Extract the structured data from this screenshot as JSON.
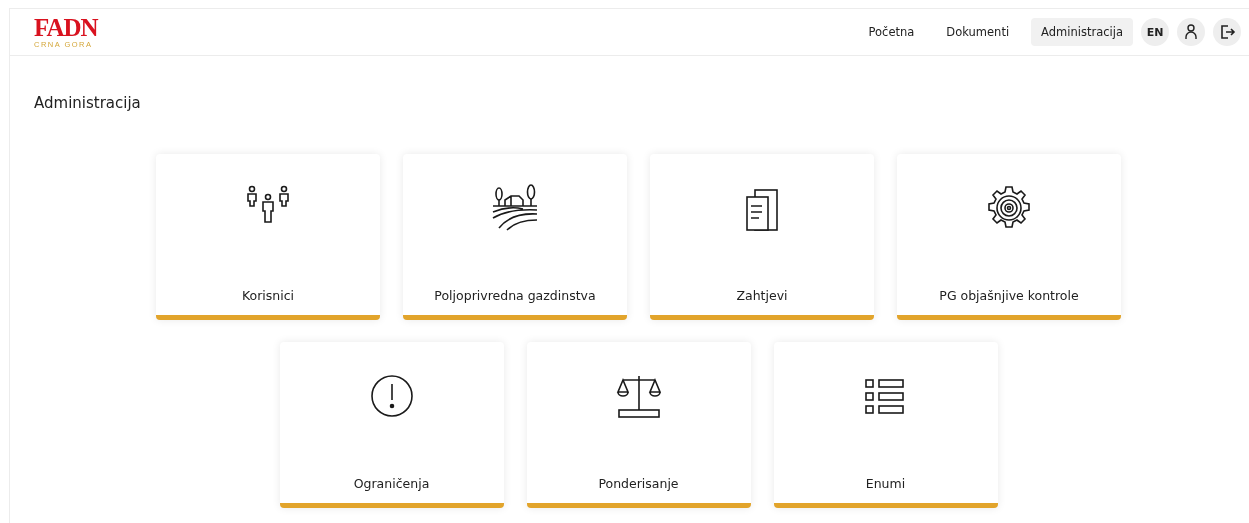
{
  "logo": {
    "title": "FADN",
    "subtitle": "CRNA GORA"
  },
  "nav": [
    {
      "label": "Početna",
      "selected": false
    },
    {
      "label": "Dokumenti",
      "selected": false
    },
    {
      "label": "Administracija",
      "selected": true
    }
  ],
  "language": "EN",
  "page_title": "Administracija",
  "tiles": [
    [
      {
        "label": "Korisnici",
        "kind": "users"
      },
      {
        "label": "Poljoprivredna gazdinstva",
        "kind": "farm"
      },
      {
        "label": "Zahtjevi",
        "kind": "documents"
      },
      {
        "label": "PG objašnjive kontrole",
        "kind": "gear"
      }
    ],
    [
      {
        "label": "Ograničenja",
        "kind": "alert"
      },
      {
        "label": "Ponderisanje",
        "kind": "scale"
      },
      {
        "label": "Enumi",
        "kind": "list"
      }
    ]
  ]
}
